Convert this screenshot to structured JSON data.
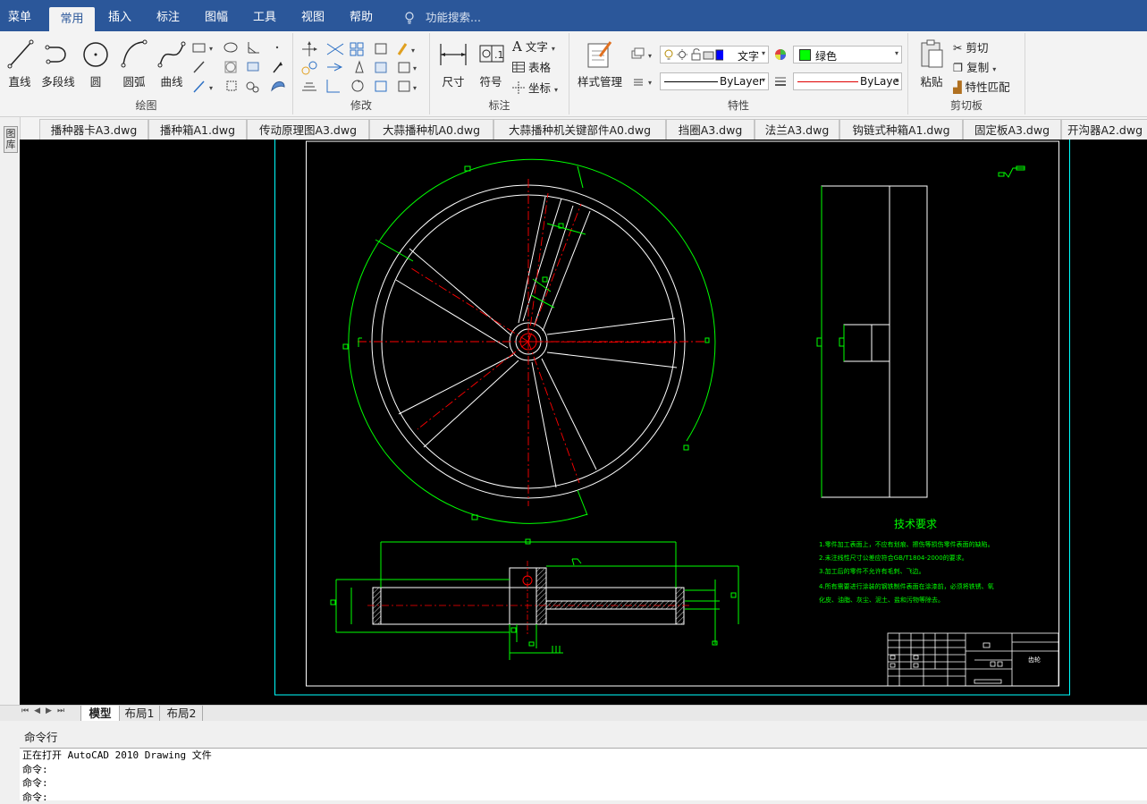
{
  "menubar": {
    "items": [
      "菜单",
      "常用",
      "插入",
      "标注",
      "图幅",
      "工具",
      "视图",
      "帮助"
    ],
    "active": "常用",
    "search_placeholder": "功能搜索..."
  },
  "ribbon": {
    "draw": {
      "title": "绘图",
      "line": "直线",
      "polyline": "多段线",
      "circle": "圆",
      "arc": "圆弧",
      "curve": "曲线"
    },
    "modify": {
      "title": "修改"
    },
    "annotate": {
      "title": "标注",
      "dimension": "尺寸",
      "symbol": "符号",
      "text": "文字",
      "table": "表格",
      "coordinate": "坐标"
    },
    "properties": {
      "title": "特性",
      "style_manager": "样式管理",
      "text_style": "文字",
      "color": "绿色",
      "linetype": "ByLayer",
      "lineweight": "ByLaye"
    },
    "clipboard": {
      "title": "剪切板",
      "paste": "粘贴",
      "cut": "剪切",
      "copy": "复制",
      "match": "特性匹配"
    }
  },
  "colors": {
    "menubar": "#2b579a",
    "cad_green": "#00ff00",
    "cad_red": "#ff0000",
    "cad_cyan": "#00ffff",
    "canvas": "#000000",
    "layer_swatch": "#0000ff"
  },
  "sidebar": {
    "label": "图库"
  },
  "document_tabs": [
    "播种器卡A3.dwg",
    "播种箱A1.dwg",
    "传动原理图A3.dwg",
    "大蒜播种机A0.dwg",
    "大蒜播种机关键部件A0.dwg",
    "挡圈A3.dwg",
    "法兰A3.dwg",
    "钩链式种箱A1.dwg",
    "固定板A3.dwg",
    "开沟器A2.dwg"
  ],
  "drawing": {
    "tech_req_title": "技术要求",
    "tech_req": [
      "1.零件加工表面上，不应有划痕、擦伤等损伤零件表面的缺陷。",
      "2.未注线性尺寸公差应符合GB/T1804-2000的要求。",
      "3.加工后的零件不允许有毛刺、飞边。",
      "4.所有需要进行涂装的钢铁制件表面在涂漆前，必须将铁锈、氧",
      "化皮、油脂、灰尘、泥土、盐和污物等除去。"
    ],
    "title_block_name": "齿轮"
  },
  "layout_tabs": [
    "模型",
    "布局1",
    "布局2"
  ],
  "command": {
    "header": "命令行",
    "lines": [
      "正在打开 AutoCAD 2010 Drawing 文件",
      "命令:",
      "命令:",
      "命令:"
    ]
  }
}
